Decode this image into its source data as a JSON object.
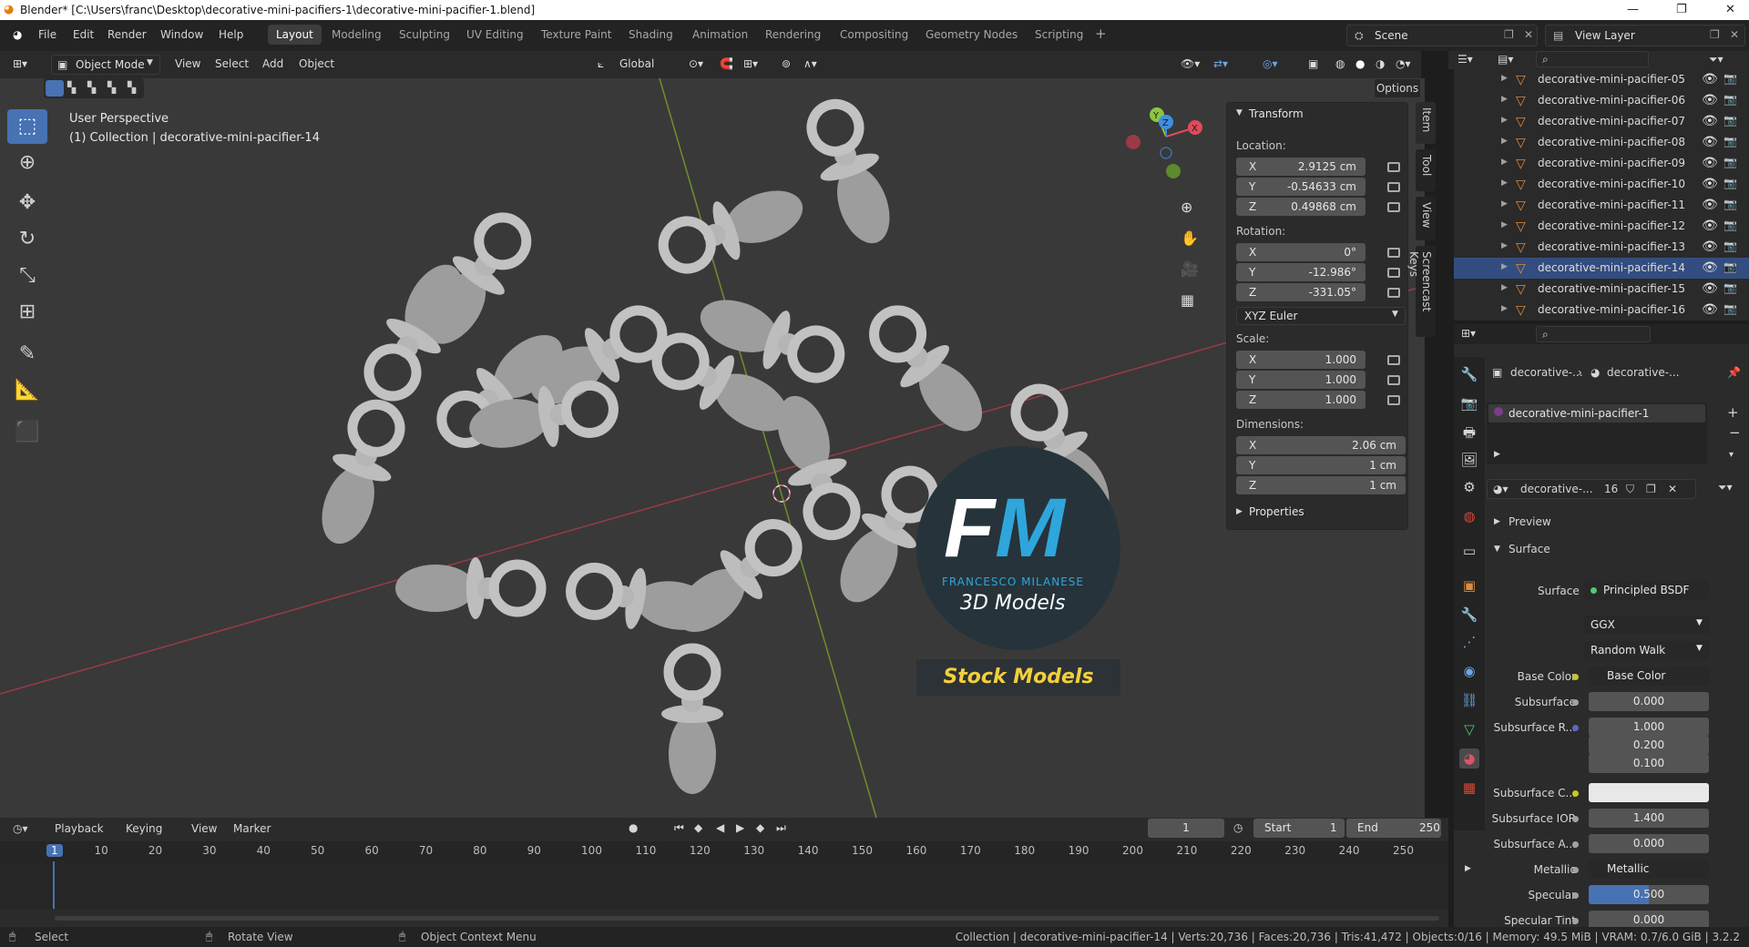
{
  "titlebar": {
    "title": "Blender* [C:\\Users\\franc\\Desktop\\decorative-mini-pacifiers-1\\decorative-mini-pacifier-1.blend]"
  },
  "menu": [
    "File",
    "Edit",
    "Render",
    "Window",
    "Help"
  ],
  "workspaces": [
    "Layout",
    "Modeling",
    "Sculpting",
    "UV Editing",
    "Texture Paint",
    "Shading",
    "Animation",
    "Rendering",
    "Compositing",
    "Geometry Nodes",
    "Scripting"
  ],
  "scene": "Scene",
  "view_layer": "View Layer",
  "header": {
    "mode": "Object Mode",
    "view": "View",
    "select": "Select",
    "add": "Add",
    "object": "Object",
    "orientation": "Global",
    "options": "Options"
  },
  "viewport": {
    "perspective": "User Perspective",
    "collection": "(1) Collection | decorative-mini-pacifier-14"
  },
  "gizmo": {
    "x": "X",
    "y": "Y",
    "z": "Z"
  },
  "npanel": {
    "section": "Transform",
    "location_label": "Location:",
    "location": [
      [
        "X",
        "2.9125 cm"
      ],
      [
        "Y",
        "-0.54633 cm"
      ],
      [
        "Z",
        "0.49868 cm"
      ]
    ],
    "rotation_label": "Rotation:",
    "rotation": [
      [
        "X",
        "0°"
      ],
      [
        "Y",
        "-12.986°"
      ],
      [
        "Z",
        "-331.05°"
      ]
    ],
    "rotation_mode": "XYZ Euler",
    "scale_label": "Scale:",
    "scale": [
      [
        "X",
        "1.000"
      ],
      [
        "Y",
        "1.000"
      ],
      [
        "Z",
        "1.000"
      ]
    ],
    "dimensions_label": "Dimensions:",
    "dimensions": [
      [
        "X",
        "2.06 cm"
      ],
      [
        "Y",
        "1 cm"
      ],
      [
        "Z",
        "1 cm"
      ]
    ],
    "properties": "Properties"
  },
  "sidetabs": [
    "Item",
    "Tool",
    "View",
    "Screencast Keys"
  ],
  "outliner": {
    "items": [
      "decorative-mini-pacifier-05",
      "decorative-mini-pacifier-06",
      "decorative-mini-pacifier-07",
      "decorative-mini-pacifier-08",
      "decorative-mini-pacifier-09",
      "decorative-mini-pacifier-10",
      "decorative-mini-pacifier-11",
      "decorative-mini-pacifier-12",
      "decorative-mini-pacifier-13",
      "decorative-mini-pacifier-14",
      "decorative-mini-pacifier-15",
      "decorative-mini-pacifier-16"
    ],
    "active_index": 9
  },
  "properties": {
    "breadcrumb_obj": "decorative-...",
    "breadcrumb_mat": "decorative-...",
    "slot": "decorative-mini-pacifier-1",
    "material_name": "decorative-...",
    "users": "16",
    "preview": "Preview",
    "surface_section": "Surface",
    "surface_label": "Surface",
    "surface_value": "Principled BSDF",
    "distribution": "GGX",
    "subsurface_method": "Random Walk",
    "rows": [
      [
        "Base Color",
        "Base Color"
      ],
      [
        "Subsurface",
        "0.000"
      ],
      [
        "Subsurface R...",
        "1.000"
      ],
      [
        "",
        "0.200"
      ],
      [
        "",
        "0.100"
      ],
      [
        "Subsurface C...",
        ""
      ],
      [
        "Subsurface IOR",
        "1.400"
      ],
      [
        "Subsurface A...",
        "0.000"
      ],
      [
        "Metallic",
        "Metallic"
      ],
      [
        "Specular",
        "0.500"
      ],
      [
        "Specular Tint",
        "0.000"
      ]
    ]
  },
  "watermark": {
    "logo": "FM",
    "author": "FRANCESCO MILANESE",
    "sub": "3D Models",
    "banner": "Stock Models"
  },
  "timeline": {
    "playback": "Playback",
    "keying": "Keying",
    "view": "View",
    "marker": "Marker",
    "current": "1",
    "start_label": "Start",
    "start": "1",
    "end_label": "End",
    "end": "250",
    "ticks": [
      "1",
      "10",
      "20",
      "30",
      "40",
      "50",
      "60",
      "70",
      "80",
      "90",
      "100",
      "110",
      "120",
      "130",
      "140",
      "150",
      "160",
      "170",
      "180",
      "190",
      "200",
      "210",
      "220",
      "230",
      "240",
      "250"
    ]
  },
  "status": {
    "select": "Select",
    "rotate": "Rotate View",
    "context": "Object Context Menu",
    "info": "Collection | decorative-mini-pacifier-14 | Verts:20,736 | Faces:20,736 | Tris:41,472 | Objects:0/16 | Memory: 49.5 MiB | VRAM: 0.7/6.0 GiB | 3.2.2"
  },
  "colors": {
    "accent": "#4772b3",
    "x_axis": "#e04a5a",
    "y_axis": "#8cc63f",
    "z_axis": "#3f8fe0",
    "watermark_blue": "#2ea6dc",
    "banner_yellow": "#f2d03b"
  }
}
